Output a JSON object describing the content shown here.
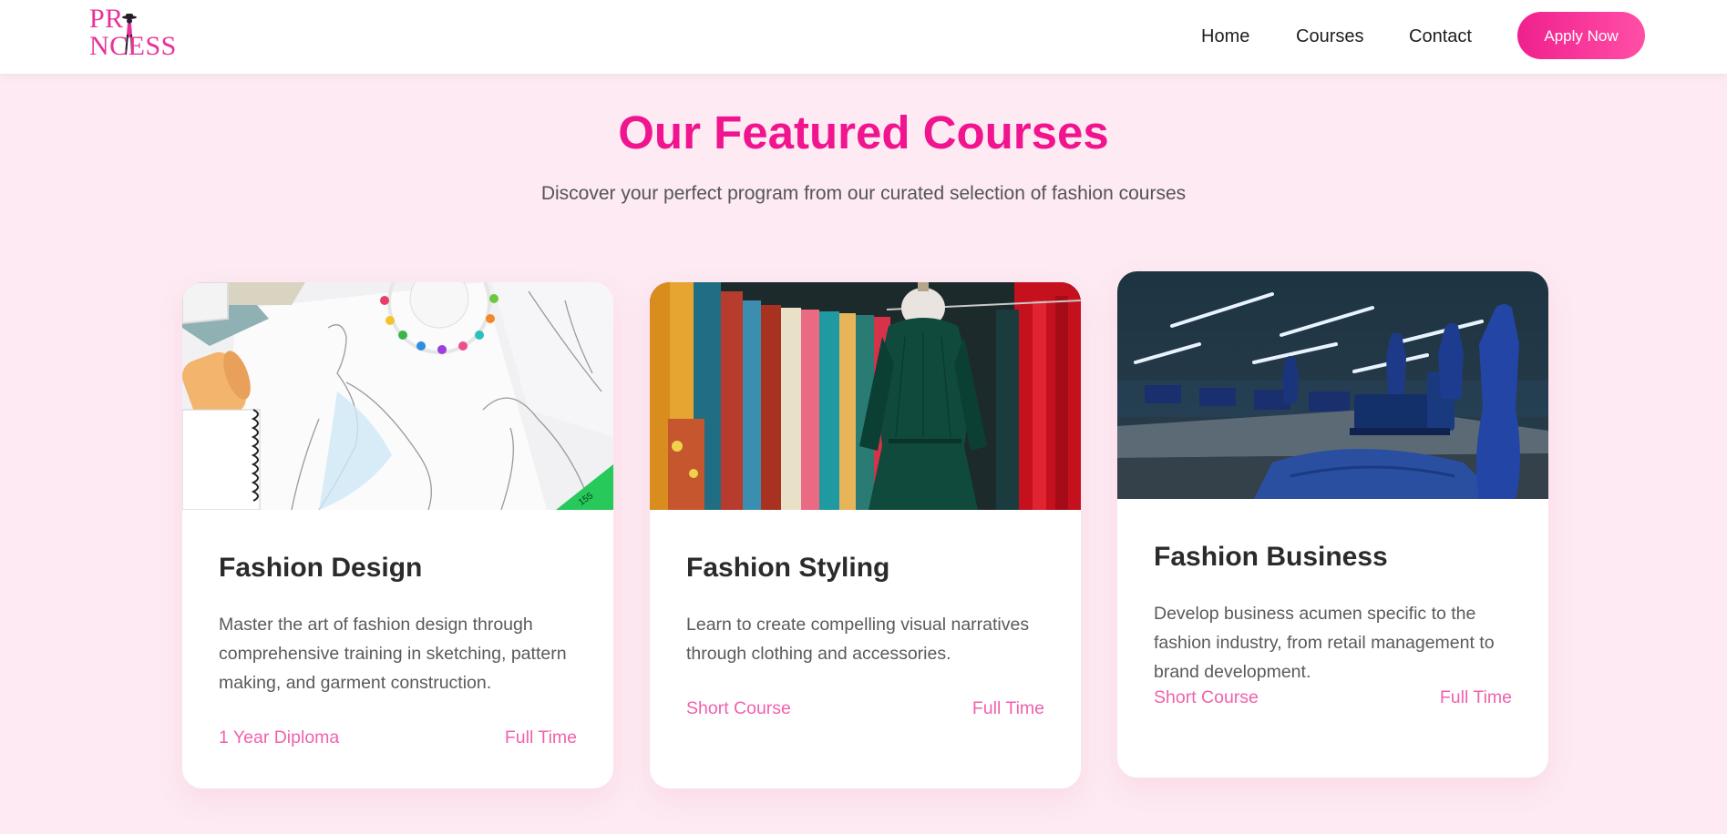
{
  "header": {
    "logo_text": "PR",
    "logo_text_rest": "NCESS",
    "nav": {
      "home": "Home",
      "courses": "Courses",
      "contact": "Contact"
    },
    "apply_label": "Apply Now"
  },
  "section": {
    "title": "Our Featured Courses",
    "subtitle": "Discover your perfect program from our curated selection of fashion courses"
  },
  "courses": [
    {
      "title": "Fashion Design",
      "description": "Master the art of fashion design through comprehensive training in sketching, pattern making, and garment construction.",
      "duration": "1 Year Diploma",
      "mode": "Full Time"
    },
    {
      "title": "Fashion Styling",
      "description": "Learn to create compelling visual narratives through clothing and accessories.",
      "duration": "Short Course",
      "mode": "Full Time"
    },
    {
      "title": "Fashion Business",
      "description": "Develop business acumen specific to the fashion industry, from retail management to brand development.",
      "duration": "Short Course",
      "mode": "Full Time"
    }
  ],
  "colors": {
    "page_background": "#fdeaf2",
    "brand_pink": "#f0158f",
    "accent_pink": "#f062ac"
  }
}
